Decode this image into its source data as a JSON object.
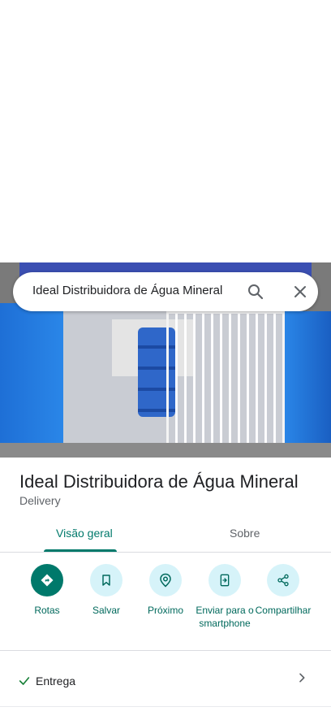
{
  "search": {
    "query": "Ideal Distribuidora de Água Mineral"
  },
  "place": {
    "name": "Ideal Distribuidora de Água Mineral",
    "category": "Delivery"
  },
  "tabs": [
    {
      "label": "Visão geral",
      "active": true
    },
    {
      "label": "Sobre",
      "active": false
    }
  ],
  "actions": [
    {
      "label": "Rotas",
      "icon": "directions-icon"
    },
    {
      "label": "Salvar",
      "icon": "bookmark-icon"
    },
    {
      "label": "Próximo",
      "icon": "nearby-icon"
    },
    {
      "label": "Enviar para o smartphone",
      "icon": "send-to-phone-icon"
    },
    {
      "label": "Compartilhar",
      "icon": "share-icon"
    }
  ],
  "attributes": [
    {
      "label": "Entrega",
      "icon": "check-icon"
    }
  ],
  "colors": {
    "accent": "#00796b",
    "action_bg": "#d6f3f9",
    "muted": "#5f6368"
  }
}
